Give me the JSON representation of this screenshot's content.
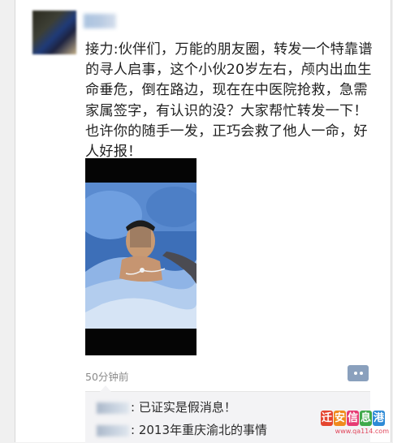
{
  "post": {
    "text": "接力:伙伴们，万能的朋友圈，转发一个特靠谱的寻人启事，这个小伙20岁左右，颅内出血生命垂危，倒在路边，现在在中医院抢救，急需家属签字，有认识的没？大家帮忙转发一下！也许你的随手一发，正巧会救了他人一命，好人好报！",
    "time": "50分钟前"
  },
  "comments": [
    {
      "sep": ":",
      "text": "已证实是假消息！"
    },
    {
      "sep": ":",
      "text": "2013年重庆渝北的事情"
    }
  ],
  "watermark": {
    "chars": [
      "迁",
      "安",
      "信",
      "息",
      "港"
    ],
    "char_colors": [
      "#e5452f",
      "#f08a1c",
      "#e63a73",
      "#3fa94a",
      "#2e8bd6"
    ],
    "url": "www.qa114.com"
  },
  "icons": {
    "comment_button": "comment-dots-icon"
  }
}
